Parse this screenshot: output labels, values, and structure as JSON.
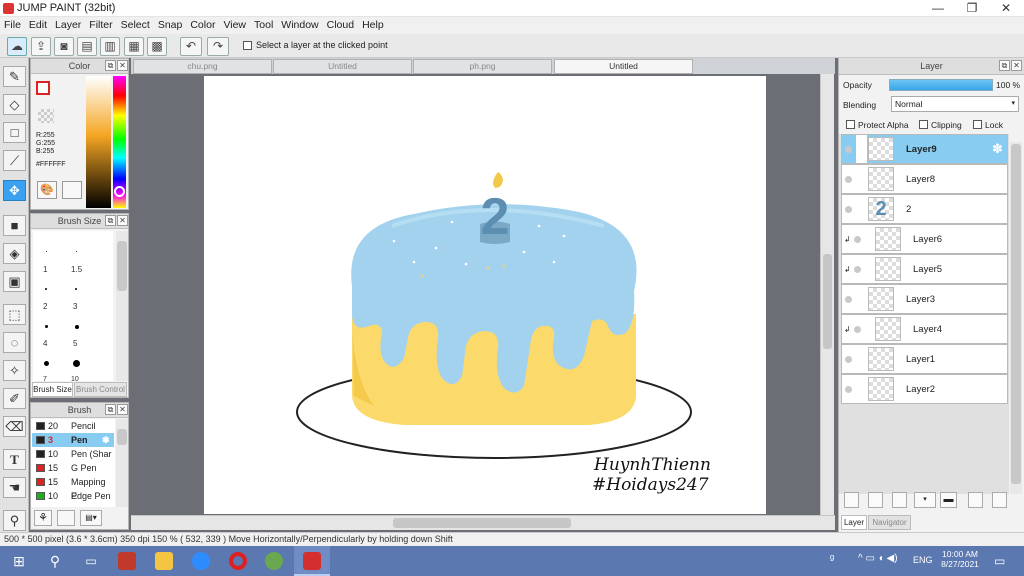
{
  "title": "JUMP PAINT (32bit)",
  "window_controls": {
    "minimize": "—",
    "maximize": "❐",
    "close": "✕"
  },
  "menu": [
    "File",
    "Edit",
    "Layer",
    "Filter",
    "Select",
    "Snap",
    "Color",
    "View",
    "Tool",
    "Window",
    "Cloud",
    "Help"
  ],
  "toolbar": {
    "select_layer_label": "Select a layer at the clicked point"
  },
  "color_panel": {
    "title": "Color",
    "r": "R:255",
    "g": "G:255",
    "b": "B:255",
    "hex": "#FFFFFF"
  },
  "brush_size_panel": {
    "title": "Brush Size",
    "sizes": [
      "1",
      "1.5",
      "2",
      "3",
      "4",
      "5",
      "7",
      "10"
    ],
    "tabs": [
      "Brush Size",
      "Brush Control"
    ]
  },
  "brush_panel": {
    "title": "Brush",
    "items": [
      {
        "size": "20",
        "name": "Pencil",
        "color": "#222222"
      },
      {
        "size": "3",
        "name": "Pen",
        "color": "#222222",
        "selected": true
      },
      {
        "size": "10",
        "name": "Pen (Shar",
        "color": "#222222"
      },
      {
        "size": "15",
        "name": "G Pen",
        "color": "#dd2222"
      },
      {
        "size": "15",
        "name": "Mapping P",
        "color": "#dd2222"
      },
      {
        "size": "10",
        "name": "Edge Pen",
        "color": "#22aa22"
      }
    ]
  },
  "tabs": [
    "chu.png",
    "Untitled",
    "ph.png",
    "Untitled"
  ],
  "canvas": {
    "signature_line1": "HuynhThienn",
    "signature_line2": "#Hoidays247",
    "cake_number": "2"
  },
  "layer_panel": {
    "title": "Layer",
    "opacity_label": "Opacity",
    "opacity_value": "100 %",
    "opacity": 1.0,
    "blending_label": "Blending",
    "blending_value": "Normal",
    "protect_alpha": "Protect Alpha",
    "clipping": "Clipping",
    "lock": "Lock",
    "layers": [
      {
        "name": "Layer9",
        "selected": true
      },
      {
        "name": "Layer8"
      },
      {
        "name": "2"
      },
      {
        "name": "Layer6",
        "clipped": true
      },
      {
        "name": "Layer5",
        "clipped": true
      },
      {
        "name": "Layer3"
      },
      {
        "name": "Layer4",
        "clipped": true
      },
      {
        "name": "Layer1"
      },
      {
        "name": "Layer2"
      }
    ],
    "bottom_tabs": [
      "Layer",
      "Navigator"
    ]
  },
  "status": "500 * 500 pixel   (3.6 * 3.6cm)   350 dpi   150 %   ( 532, 339 )   Move Horizontally/Perpendicularly by holding down Shift",
  "taskbar": {
    "time": "10:00 AM",
    "date": "8/27/2021",
    "lang": "ENG"
  }
}
